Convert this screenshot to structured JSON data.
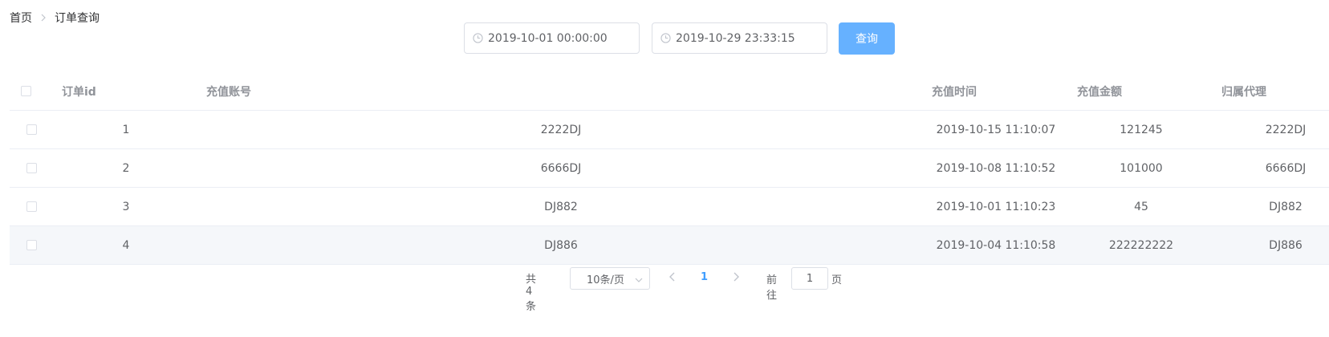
{
  "breadcrumb": {
    "home": "首页",
    "current": "订单查询"
  },
  "filters": {
    "start_date": "2019-10-01 00:00:00",
    "end_date": "2019-10-29 23:33:15",
    "query_label": "查询"
  },
  "table": {
    "columns": {
      "order_id": "订单id",
      "account": "充值账号",
      "time": "充值时间",
      "amount": "充值金额",
      "agent": "归属代理"
    },
    "rows": [
      {
        "id": "1",
        "account": "2222DJ",
        "time": "2019-10-15 11:10:07",
        "amount": "121245",
        "agent": "2222DJ"
      },
      {
        "id": "2",
        "account": "6666DJ",
        "time": "2019-10-08 11:10:52",
        "amount": "101000",
        "agent": "6666DJ"
      },
      {
        "id": "3",
        "account": "DJ882",
        "time": "2019-10-01 11:10:23",
        "amount": "45",
        "agent": "DJ882"
      },
      {
        "id": "4",
        "account": "DJ886",
        "time": "2019-10-04 11:10:58",
        "amount": "222222222",
        "agent": "DJ886"
      }
    ]
  },
  "pagination": {
    "total": "共 4 条",
    "page_size": "10条/页",
    "current_page": "1",
    "goto_label": "前往",
    "goto_value": "1",
    "goto_unit": "页"
  },
  "colors": {
    "primary": "#409eff",
    "button_bg": "#66b1ff",
    "border": "#dcdfe6",
    "row_hover": "#f5f7fa"
  },
  "icons": {
    "date_inputs": "clock-icon",
    "breadcrumb_separator": "chevron-right-icon",
    "page_size": "chevron-down-icon",
    "prev": "chevron-left-icon",
    "next": "chevron-right-icon"
  }
}
